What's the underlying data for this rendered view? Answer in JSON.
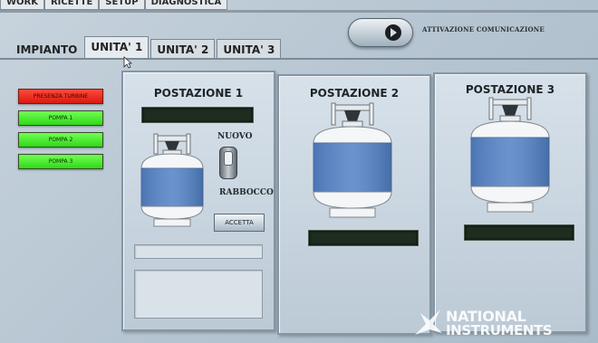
{
  "top_tabs": [
    "WORK",
    "RICETTE",
    "SETUP",
    "DIAGNOSTICA"
  ],
  "tabs": [
    {
      "label": "IMPIANTO"
    },
    {
      "label": "UNITA' 1",
      "active": true
    },
    {
      "label": "UNITA' 2"
    },
    {
      "label": "UNITA' 3"
    }
  ],
  "activation": {
    "label": "ATTIVAZIONE COMUNICAZIONE"
  },
  "indicators": [
    {
      "label": "PRESENZA TURBINE",
      "color": "#e8241a"
    },
    {
      "label": "POMPA 1",
      "color": "#3fe824"
    },
    {
      "label": "POMPA 2",
      "color": "#3fe824"
    },
    {
      "label": "POMPA 3",
      "color": "#3fe824"
    }
  ],
  "stations": [
    {
      "title": "POSTAZIONE 1",
      "toggle_top": "NUOVO",
      "toggle_bottom": "RABBOCCO",
      "button": "ACCETTA"
    },
    {
      "title": "POSTAZIONE 2"
    },
    {
      "title": "POSTAZIONE 3"
    }
  ],
  "logo": {
    "line1": "NATIONAL",
    "line2": "INSTRUMENTS"
  }
}
